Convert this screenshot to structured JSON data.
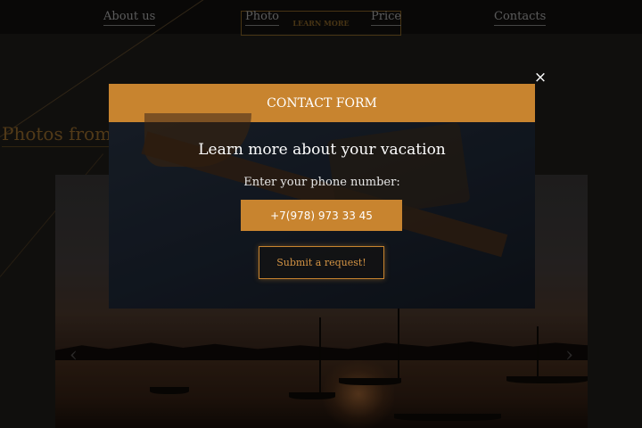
{
  "nav": {
    "about": "About us",
    "photo": "Photo",
    "price": "Price",
    "contacts": "Contacts",
    "learn_more": "LEARN MORE"
  },
  "section": {
    "title": "Photos from"
  },
  "slider": {
    "prev_icon": "chevron-left-icon",
    "next_icon": "chevron-right-icon"
  },
  "modal": {
    "close_icon": "close-icon",
    "close_glyph": "×",
    "header": "CONTACT FORM",
    "title": "Learn more about your vacation",
    "phone_label": "Enter your phone number:",
    "phone_value": "+7(978) 973 33 45",
    "submit_label": "Submit a request!"
  },
  "colors": {
    "accent": "#c8842f",
    "background": "#151310",
    "modal_body": "#1d2634"
  }
}
